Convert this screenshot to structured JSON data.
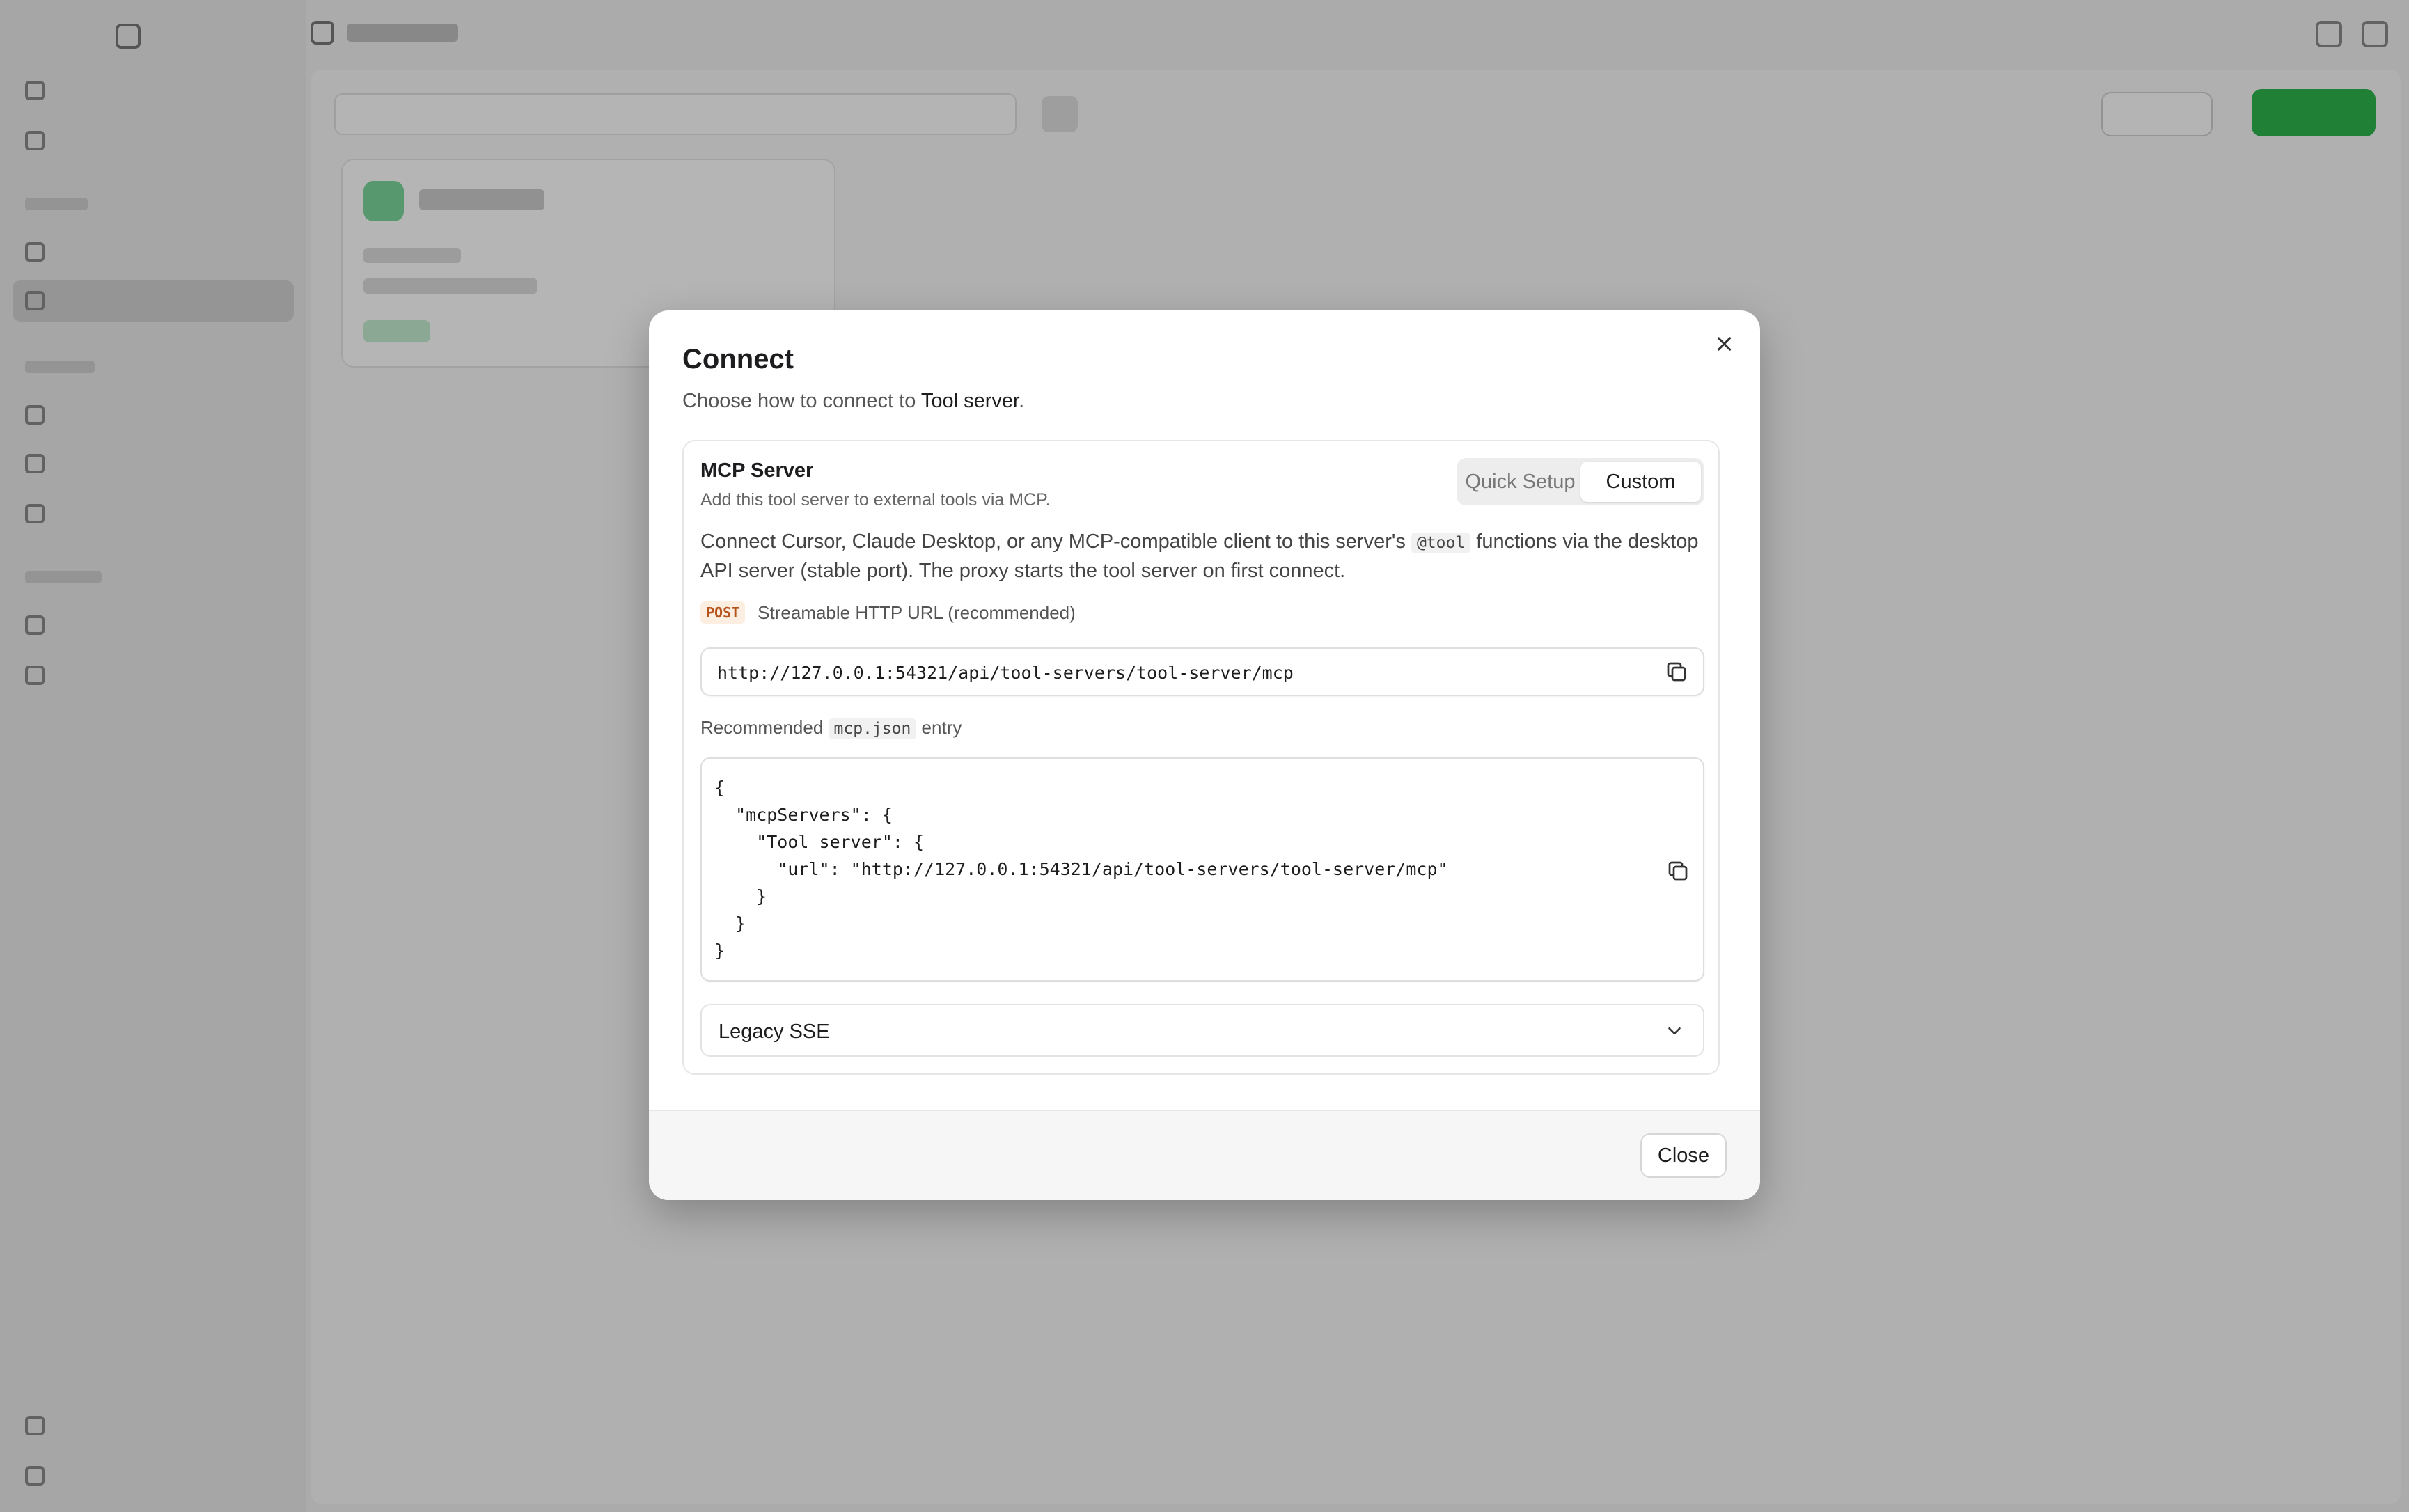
{
  "dialog": {
    "title": "Connect",
    "subtitle_prefix": "Choose how to connect to ",
    "subtitle_target": "Tool server",
    "subtitle_suffix": ".",
    "close_label": "Close"
  },
  "mcp_panel": {
    "title": "MCP Server",
    "description": "Add this tool server to external tools via MCP.",
    "tabs": [
      {
        "label": "Quick Setup",
        "active": false
      },
      {
        "label": "Custom",
        "active": true
      }
    ],
    "intro_before": "Connect Cursor, Claude Desktop, or any MCP-compatible client to this server's ",
    "intro_code": "@tool",
    "intro_after": " functions via the desktop API server (stable port). The proxy starts the tool server on first connect.",
    "method_badge": "POST",
    "method_label": "Streamable HTTP URL (recommended)",
    "url": "http://127.0.0.1:54321/api/tool-servers/tool-server/mcp",
    "recommended_prefix": "Recommended ",
    "recommended_code": "mcp.json",
    "recommended_suffix": " entry",
    "json_entry": "{\n  \"mcpServers\": {\n    \"Tool server\": {\n      \"url\": \"http://127.0.0.1:54321/api/tool-servers/tool-server/mcp\"\n    }\n  }\n}",
    "legacy_label": "Legacy SSE"
  },
  "icons": {
    "copy": "copy-icon",
    "chevron": "chevron-down-icon",
    "close": "close-icon"
  },
  "colors": {
    "method_badge": "#b6541c",
    "create_button": "#2bb24c"
  }
}
